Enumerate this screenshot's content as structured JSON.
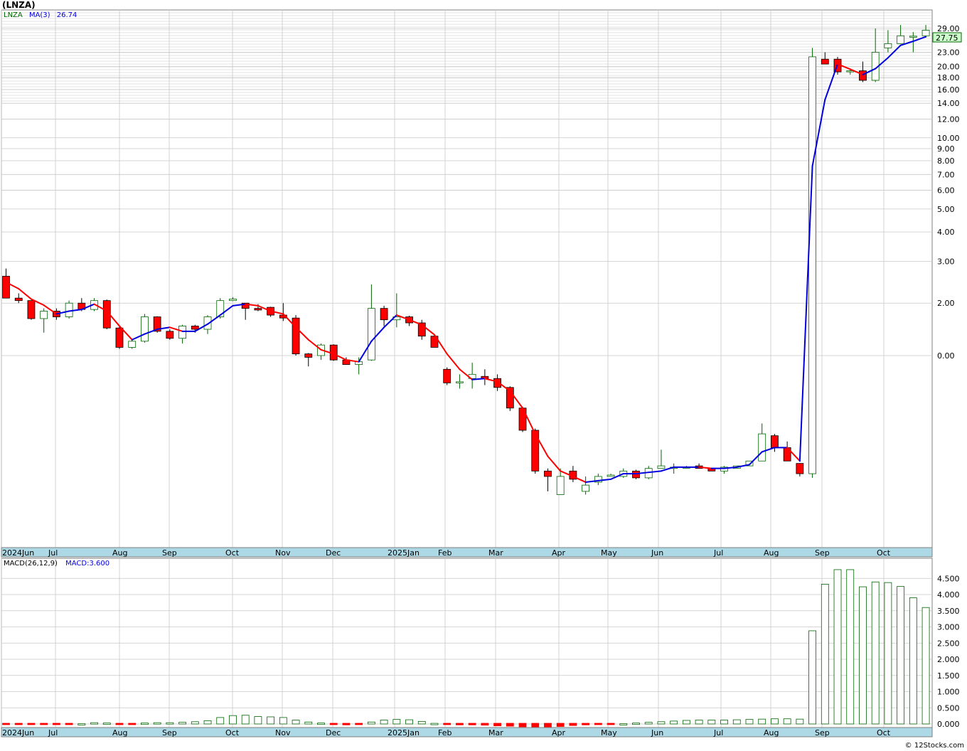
{
  "symbol_title": "(LNZA)",
  "legend": {
    "symbol": "LNZA",
    "ma_label": "MA(3)",
    "ma_value": "26.74",
    "macd_label": "MACD(26,12,9)",
    "macd_value": "MACD:3.600"
  },
  "last_price_tag": "27.75",
  "watermark": "© 12Stocks.com",
  "colors": {
    "up": "#006400",
    "down": "#ff0000",
    "ma_up": "#0000dd",
    "ma_down": "#ff0000",
    "grid": "#c8c8c8",
    "axis_band": "#add8e6",
    "tag_bg": "#ccffcc"
  },
  "chart_data": [
    {
      "type": "candlestick",
      "name": "price",
      "scale": "log",
      "y_ticks": [
        "29.00",
        "23.00",
        "20.00",
        "18.00",
        "16.00",
        "14.00",
        "12.00",
        "10.00",
        "9.00",
        "8.00",
        "7.00",
        "6.00",
        "5.00",
        "4.00",
        "3.00",
        "2.00",
        "0.00"
      ],
      "x_labels": [
        "2024Jun",
        "Jul",
        "Aug",
        "Sep",
        "Oct",
        "Nov",
        "Dec",
        "2025Jan",
        "Feb",
        "Mar",
        "Apr",
        "May",
        "Jun",
        "Jul",
        "Aug",
        "Sep",
        "Oct"
      ],
      "candles": [
        [
          2.6,
          2.8,
          2.1,
          2.1
        ],
        [
          2.1,
          2.2,
          2.0,
          2.05
        ],
        [
          2.05,
          2.05,
          1.7,
          1.72
        ],
        [
          1.72,
          1.9,
          1.5,
          1.85
        ],
        [
          1.85,
          1.9,
          1.7,
          1.75
        ],
        [
          1.75,
          2.05,
          1.72,
          2.0
        ],
        [
          2.0,
          2.1,
          1.85,
          1.88
        ],
        [
          1.88,
          2.1,
          1.85,
          2.05
        ],
        [
          2.05,
          2.07,
          1.55,
          1.57
        ],
        [
          1.57,
          1.6,
          1.28,
          1.3
        ],
        [
          1.3,
          1.4,
          1.28,
          1.38
        ],
        [
          1.38,
          1.8,
          1.36,
          1.75
        ],
        [
          1.75,
          1.76,
          1.5,
          1.52
        ],
        [
          1.52,
          1.55,
          1.4,
          1.42
        ],
        [
          1.42,
          1.62,
          1.35,
          1.6
        ],
        [
          1.6,
          1.62,
          1.5,
          1.55
        ],
        [
          1.55,
          1.78,
          1.48,
          1.75
        ],
        [
          1.75,
          2.1,
          1.72,
          2.05
        ],
        [
          2.05,
          2.12,
          2.04,
          2.08
        ],
        [
          2.0,
          2.0,
          1.7,
          1.9
        ],
        [
          1.9,
          1.98,
          1.85,
          1.87
        ],
        [
          1.92,
          1.93,
          1.75,
          1.78
        ],
        [
          1.78,
          2.0,
          1.68,
          1.73
        ],
        [
          1.73,
          1.78,
          1.2,
          1.22
        ],
        [
          1.22,
          1.23,
          1.08,
          1.18
        ],
        [
          1.2,
          1.35,
          1.15,
          1.33
        ],
        [
          1.33,
          1.34,
          1.14,
          1.15
        ],
        [
          1.15,
          1.18,
          1.1,
          1.1
        ],
        [
          1.1,
          1.18,
          1.0,
          1.13
        ],
        [
          1.15,
          2.4,
          1.14,
          1.9
        ],
        [
          1.9,
          1.95,
          1.6,
          1.7
        ],
        [
          1.7,
          2.2,
          1.58,
          1.75
        ],
        [
          1.75,
          1.77,
          1.6,
          1.65
        ],
        [
          1.65,
          1.7,
          1.4,
          1.45
        ],
        [
          1.45,
          1.48,
          1.3,
          1.3
        ],
        [
          1.05,
          1.07,
          0.9,
          0.92
        ],
        [
          0.92,
          1.0,
          0.87,
          0.93
        ],
        [
          0.96,
          1.12,
          0.87,
          1.0
        ],
        [
          0.98,
          1.05,
          0.9,
          0.96
        ],
        [
          0.96,
          1.0,
          0.85,
          0.88
        ],
        [
          0.88,
          0.89,
          0.7,
          0.72
        ],
        [
          0.72,
          0.73,
          0.57,
          0.58
        ],
        [
          0.58,
          0.59,
          0.38,
          0.39
        ],
        [
          0.39,
          0.4,
          0.32,
          0.37
        ],
        [
          0.31,
          0.4,
          0.31,
          0.37
        ],
        [
          0.39,
          0.41,
          0.35,
          0.36
        ],
        [
          0.32,
          0.37,
          0.31,
          0.34
        ],
        [
          0.35,
          0.38,
          0.34,
          0.37
        ],
        [
          0.37,
          0.38,
          0.37,
          0.375
        ],
        [
          0.37,
          0.4,
          0.365,
          0.39
        ],
        [
          0.39,
          0.395,
          0.36,
          0.365
        ],
        [
          0.365,
          0.41,
          0.36,
          0.4
        ],
        [
          0.4,
          0.48,
          0.4,
          0.41
        ],
        [
          0.4,
          0.42,
          0.38,
          0.405
        ],
        [
          0.405,
          0.41,
          0.405,
          0.405
        ],
        [
          0.41,
          0.42,
          0.4,
          0.4
        ],
        [
          0.4,
          0.4,
          0.39,
          0.39
        ],
        [
          0.39,
          0.41,
          0.38,
          0.405
        ],
        [
          0.4,
          0.41,
          0.4,
          0.41
        ],
        [
          0.41,
          0.43,
          0.41,
          0.43
        ],
        [
          0.43,
          0.62,
          0.43,
          0.56
        ],
        [
          0.55,
          0.56,
          0.47,
          0.49
        ],
        [
          0.49,
          0.52,
          0.43,
          0.43
        ],
        [
          0.42,
          0.42,
          0.37,
          0.38
        ],
        [
          0.38,
          24.0,
          0.365,
          22.0
        ],
        [
          21.5,
          23.0,
          21.0,
          20.5
        ],
        [
          21.5,
          22.0,
          18.5,
          19.0
        ],
        [
          19.0,
          19.5,
          18.5,
          19.2
        ],
        [
          19.2,
          21.0,
          17.2,
          17.5
        ],
        [
          17.5,
          29.0,
          17.2,
          23.0
        ],
        [
          24.0,
          28.5,
          23.0,
          25.0
        ],
        [
          25.0,
          30.0,
          25.0,
          27.0
        ],
        [
          26.8,
          28.0,
          23.0,
          26.9
        ],
        [
          27.0,
          30.0,
          26.5,
          28.5
        ]
      ],
      "ma": [
        2.45,
        2.3,
        2.08,
        1.96,
        1.8,
        1.85,
        1.88,
        1.98,
        1.85,
        1.6,
        1.4,
        1.48,
        1.55,
        1.58,
        1.52,
        1.52,
        1.63,
        1.78,
        1.95,
        1.98,
        1.95,
        1.85,
        1.8,
        1.58,
        1.4,
        1.27,
        1.22,
        1.15,
        1.13,
        1.38,
        1.58,
        1.78,
        1.7,
        1.62,
        1.47,
        1.22,
        1.05,
        0.95,
        0.96,
        0.93,
        0.85,
        0.72,
        0.56,
        0.45,
        0.39,
        0.37,
        0.35,
        0.355,
        0.36,
        0.38,
        0.38,
        0.385,
        0.39,
        0.405,
        0.405,
        0.405,
        0.4,
        0.4,
        0.405,
        0.415,
        0.47,
        0.49,
        0.49,
        0.43,
        7.6,
        14.5,
        20.5,
        19.5,
        18.5,
        19.6,
        21.8,
        24.6,
        25.6,
        26.74
      ]
    },
    {
      "type": "bar",
      "name": "MACD",
      "y_ticks": [
        "4.500",
        "4.000",
        "3.500",
        "3.000",
        "2.500",
        "2.000",
        "1.500",
        "1.000",
        "0.500",
        "0.000"
      ],
      "ylim": [
        0,
        4.9
      ],
      "values": [
        -0.03,
        -0.04,
        -0.04,
        -0.04,
        -0.03,
        -0.02,
        0.01,
        0.04,
        0.03,
        -0.01,
        -0.02,
        0.03,
        0.04,
        0.04,
        0.05,
        0.07,
        0.1,
        0.2,
        0.26,
        0.27,
        0.23,
        0.22,
        0.2,
        0.12,
        0.06,
        0.03,
        -0.02,
        -0.05,
        -0.03,
        0.06,
        0.12,
        0.14,
        0.13,
        0.08,
        0.02,
        -0.04,
        -0.05,
        -0.05,
        -0.06,
        -0.08,
        -0.09,
        -0.11,
        -0.12,
        -0.12,
        -0.1,
        -0.07,
        -0.05,
        -0.03,
        -0.01,
        0.01,
        0.03,
        0.05,
        0.07,
        0.09,
        0.11,
        0.12,
        0.12,
        0.12,
        0.13,
        0.14,
        0.15,
        0.16,
        0.16,
        0.15,
        2.88,
        4.32,
        4.77,
        4.77,
        4.24,
        4.39,
        4.37,
        4.25,
        3.9,
        3.6
      ]
    }
  ]
}
